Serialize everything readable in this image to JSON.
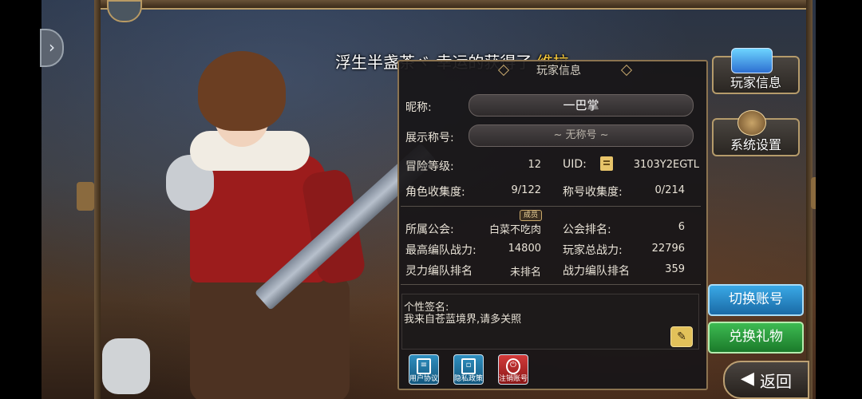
{
  "announcement": {
    "player": "浮生半盏茶ヾ",
    "middle": "幸运的获得了",
    "item": "维拉"
  },
  "panel": {
    "title": "玩家信息",
    "nickname_label": "昵称:",
    "nickname_value": "一巴掌",
    "display_title_label": "展示称号:",
    "display_title_value": "~ 无称号 ~",
    "level_label": "冒险等级:",
    "level_value": "12",
    "uid_label": "UID:",
    "uid_value": "3103Y2EGTL",
    "char_collect_label": "角色收集度:",
    "char_collect_value": "9/122",
    "title_collect_label": "称号收集度:",
    "title_collect_value": "0/214",
    "guild_label": "所属公会:",
    "guild_value": "白菜不吃肉",
    "guild_role": "成员",
    "guild_rank_label": "公会排名:",
    "guild_rank_value": "6",
    "best_team_power_label": "最高编队战力:",
    "best_team_power_value": "14800",
    "total_power_label": "玩家总战力:",
    "total_power_value": "22796",
    "spirit_rank_label": "灵力编队排名",
    "spirit_rank_value": "未排名",
    "power_rank_label": "战力编队排名",
    "power_rank_value": "359",
    "signature_label": "个性签名:",
    "signature_text": "我来自苍蓝境界,请多关照"
  },
  "footer_buttons": {
    "user_agreement": "用户协议",
    "privacy_policy": "隐私政策",
    "cancel_account": "注销账号"
  },
  "right_menu": {
    "player_info": "玩家信息",
    "system_settings": "系统设置",
    "switch_account": "切换账号",
    "redeem_gift": "兑换礼物",
    "back": "返回"
  },
  "colors": {
    "highlight": "#ffcf3a",
    "panel_bg": "#181618",
    "blue_button": "#1a6aa6",
    "green_button": "#1b7a2a",
    "red_button": "#8a1717"
  }
}
